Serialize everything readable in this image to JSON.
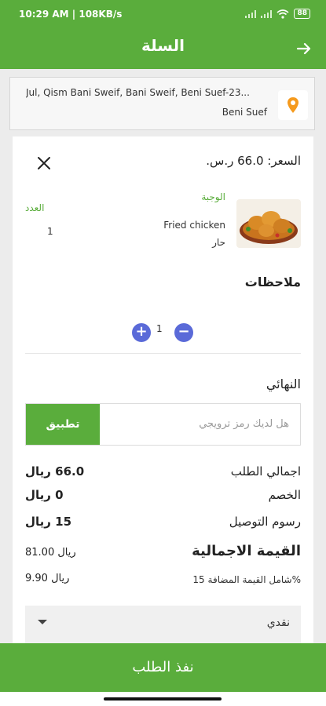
{
  "status_bar": {
    "time": "10:29 AM | 108KB/s",
    "battery": "88"
  },
  "header": {
    "title": "السلة"
  },
  "address": {
    "line1": "Jul, Qism Bani Sweif, Bani Sweif, Beni Suef-23...",
    "line2": "Beni Suef"
  },
  "item": {
    "price": "السعر: 66.0 ر.س.",
    "meal_label": "الوجبة",
    "qty_label": "العدد",
    "meal_name": "Fried chicken",
    "meal_option": "حار",
    "meal_qty": "1"
  },
  "notes": {
    "title": "ملاحظات"
  },
  "stepper": {
    "value": "1"
  },
  "summary": {
    "final_title": "النهائي",
    "coupon_placeholder": "هل لديك رمز ترويجي",
    "apply_label": "تطبيق",
    "order_total_label": "اجمالي الطلب",
    "order_total_value": "66.0 ريال",
    "discount_label": "الخصم",
    "discount_value": "0 ريال",
    "delivery_label": "رسوم التوصيل",
    "delivery_value": "15 ريال",
    "grand_total_label": "القيمة الاجمالية",
    "grand_total_value": "81.00 ريال",
    "vat_label": "شامل القيمة المضافة 15%",
    "vat_value": "9.90 ريال"
  },
  "payment": {
    "selected": "نقدي"
  },
  "footer": {
    "submit_label": "نفذ الطلب"
  }
}
